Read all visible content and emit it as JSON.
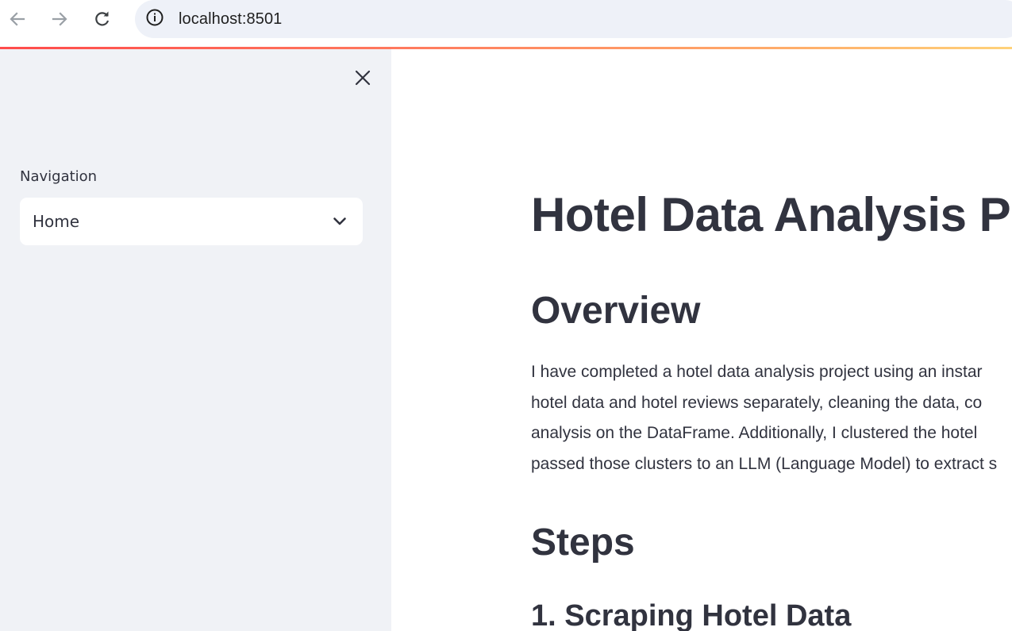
{
  "browser": {
    "url": "localhost:8501",
    "icons": {
      "back": "arrow-left-icon",
      "forward": "arrow-right-icon",
      "reload": "reload-icon",
      "site_info": "info-icon"
    }
  },
  "sidebar": {
    "close_icon": "close-icon",
    "navigation_label": "Navigation",
    "navigation_select": {
      "selected": "Home",
      "icon": "chevron-down-icon"
    }
  },
  "main": {
    "title": "Hotel Data Analysis P",
    "overview": {
      "heading": "Overview",
      "lines": [
        "I have completed a hotel data analysis project using an instar",
        "hotel data and hotel reviews separately, cleaning the data, co",
        "analysis on the DataFrame. Additionally, I clustered the hotel",
        "passed those clusters to an LLM (Language Model) to extract s"
      ]
    },
    "steps": {
      "heading": "Steps",
      "first_step": "1. Scraping Hotel Data"
    }
  },
  "colors": {
    "sidebar_bg": "#f0f2f6",
    "text": "#31333f",
    "address_bar_bg": "#eef1f8",
    "accent": "#ff4b4b"
  }
}
